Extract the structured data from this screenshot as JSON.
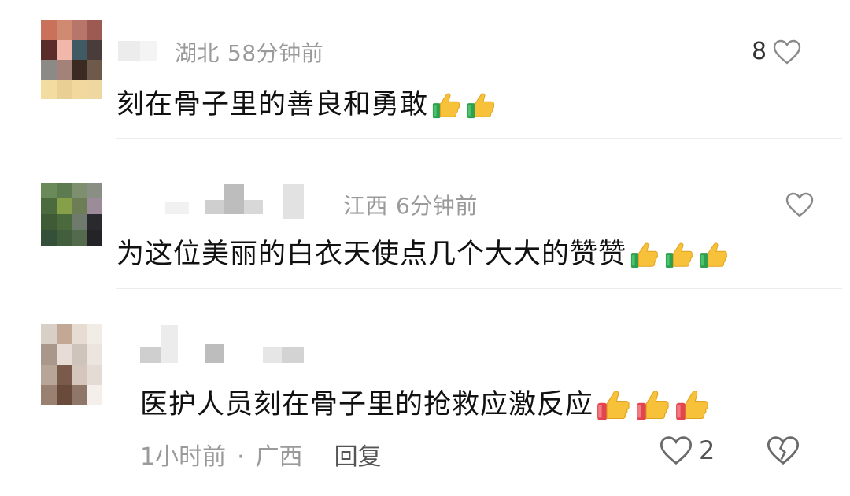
{
  "comments": [
    {
      "location": "湖北",
      "time": "58分钟前",
      "text": "刻在骨子里的善良和勇敢",
      "emojis": [
        "thumbs-up-icon",
        "thumbs-up-icon"
      ],
      "like_count": "8"
    },
    {
      "location": "江西",
      "time": "6分钟前",
      "text": "为这位美丽的白衣天使点几个大大的赞赞",
      "emojis": [
        "thumbs-up-icon",
        "thumbs-up-icon",
        "thumbs-up-icon"
      ],
      "like_count": ""
    },
    {
      "text": "医护人员刻在骨子里的抢救应激反应",
      "emojis": [
        "thumbs-up-icon",
        "thumbs-up-icon",
        "thumbs-up-icon"
      ],
      "time": "1小时前",
      "separator": "·",
      "location": "广西",
      "reply_label": "回复",
      "like_count": "2"
    }
  ],
  "colors": {
    "meta_text": "#9a9a9a",
    "body_text": "#111111",
    "divider": "#ececec",
    "thumb_yellow": "#f7c23a",
    "thumb_cuff_green": "#2e9e4f",
    "thumb_cuff_red": "#e2454f"
  }
}
